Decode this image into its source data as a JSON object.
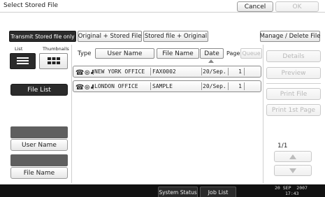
{
  "header": {
    "title": "Select Stored File",
    "cancel_label": "Cancel",
    "ok_label": "OK"
  },
  "tabs": [
    {
      "label": "Transmit Stored file only"
    },
    {
      "label": "Original + Stored File"
    },
    {
      "label": "Stored file + Original"
    }
  ],
  "manage_label": "Manage / Delete File",
  "view": {
    "list_label": "List",
    "thumbnails_label": "Thumbnails"
  },
  "left_buttons": {
    "file_list": "File List",
    "user_name": "User Name",
    "file_name": "File Name"
  },
  "table": {
    "type_label": "Type",
    "columns": {
      "user_name": "User Name",
      "file_name": "File Name",
      "date": "Date",
      "page": "Page",
      "queue": "Queue"
    },
    "rows": [
      {
        "user": "NEW YORK OFFICE",
        "file": "FAX0002",
        "date": "20/Sep.",
        "pages": "1"
      },
      {
        "user": "LONDON OFFICE",
        "file": "SAMPLE",
        "date": "20/Sep.",
        "pages": "1"
      }
    ]
  },
  "right_panel": {
    "details": "Details",
    "preview": "Preview",
    "print_file": "Print File",
    "print_first_page": "Print 1st Page",
    "page_indicator": "1/1"
  },
  "footer": {
    "system_status": "System Status",
    "job_list": "Job List",
    "date": "20 SEP  2007",
    "time": "17:43"
  },
  "icons": {
    "sort": "triangle-up-icon",
    "scroll_up": "triangle-up-icon",
    "scroll_down": "triangle-down-icon"
  },
  "colors": {
    "active_tab": "#2b2b2b",
    "footer_bar": "#111111",
    "gray_button": "#5f5f5f"
  }
}
